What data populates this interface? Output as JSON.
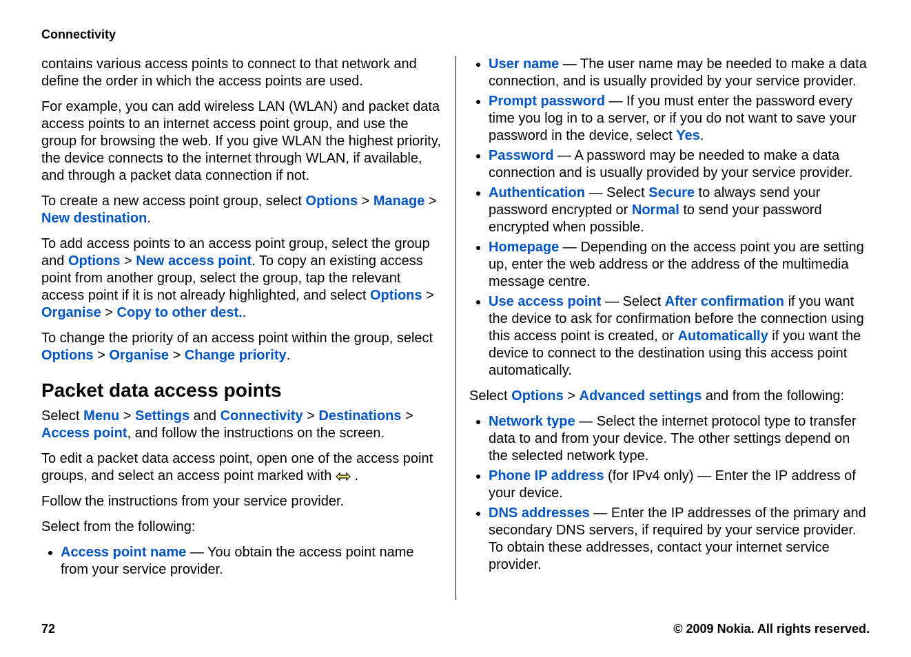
{
  "header": {
    "section": "Connectivity"
  },
  "col1": {
    "p1": "contains various access points to connect to that network and define the order in which the access points are used.",
    "p2": "For example, you can add wireless LAN (WLAN) and packet data access points to an internet access point group, and use the group for browsing the web. If you give WLAN the highest priority, the device connects to the internet through WLAN, if available, and through a packet data connection if not.",
    "p3": {
      "pre": "To create a new access point group, select ",
      "opt": "Options",
      "sep1": "  > ",
      "manage": "Manage",
      "sep2": "  > ",
      "newdest": "New destination",
      "post": "."
    },
    "p4": {
      "t1": "To add access points to an access point group, select the group and ",
      "opt": "Options",
      "sep1": "  > ",
      "nap": "New access point",
      "t2": ". To copy an existing access point from another group, select the group, tap the relevant access point if it is not already highlighted, and select ",
      "opt2": "Options",
      "sep2": "  > ",
      "org": "Organise",
      "sep3": "  > ",
      "copy": "Copy to other dest.",
      "t3": "."
    },
    "p5": {
      "t1": "To change the priority of an access point within the group, select ",
      "opt": "Options",
      "sep1": "  > ",
      "org": "Organise",
      "sep2": "  > ",
      "chg": "Change priority",
      "t2": "."
    },
    "h2": "Packet data access points",
    "p6": {
      "t1": "Select ",
      "menu": "Menu",
      "sep1": "  > ",
      "settings": "Settings",
      "and": " and ",
      "conn": "Connectivity",
      "sep2": "  > ",
      "dest": "Destinations",
      "sep3": "  > ",
      "ap": "Access point",
      "t2": ", and follow the instructions on the screen."
    },
    "p7": {
      "t1": "To edit a packet data access point, open one of the access point groups, and select an access point marked with ",
      "t2": "."
    },
    "p8": "Follow the instructions from your service provider.",
    "p9": "Select from the following:",
    "list1": {
      "apn_label": "Access point name",
      "apn_text": "  — You obtain the access point name from your service provider."
    }
  },
  "col2": {
    "list_top": [
      {
        "label": "User name",
        "text": "  — The user name may be needed to make a data connection, and is usually provided by your service provider."
      },
      {
        "label": "Prompt password",
        "pre": "  — If you must enter the password every time you log in to a server, or if you do not want to save your password in the device, select ",
        "cmd1": "Yes",
        "post": "."
      },
      {
        "label": "Password",
        "text": "  — A password may be needed to make a data connection and is usually provided by your service provider."
      },
      {
        "label": "Authentication",
        "pre": "  — Select ",
        "cmd1": "Secure",
        "mid": " to always send your password encrypted or ",
        "cmd2": "Normal",
        "post": " to send your password encrypted when possible."
      },
      {
        "label": "Homepage",
        "text": "  — Depending on the access point you are setting up, enter the web address or the address of the multimedia message centre."
      },
      {
        "label": "Use access point",
        "pre": "  — Select ",
        "cmd1": "After confirmation",
        "mid": " if you want the device to ask for confirmation before the connection using this access point is created, or ",
        "cmd2": "Automatically",
        "post": " if you want the device to connect to the destination using this access point automatically."
      }
    ],
    "p_mid": {
      "t1": "Select ",
      "opt": "Options",
      "sep": "  > ",
      "adv": "Advanced settings",
      "t2": " and from the following:"
    },
    "list_bottom": [
      {
        "label": "Network type",
        "text": "  — Select the internet protocol type to transfer data to and from your device. The other settings depend on the selected network type."
      },
      {
        "label": "Phone IP address",
        "post_label": " (for IPv4 only) — Enter the IP address of your device."
      },
      {
        "label": "DNS addresses",
        "text": "  — Enter the IP addresses of the primary and secondary DNS servers, if required by your service provider. To obtain these addresses, contact your internet service provider."
      }
    ]
  },
  "footer": {
    "page": "72",
    "copyright": "© 2009 Nokia. All rights reserved."
  }
}
